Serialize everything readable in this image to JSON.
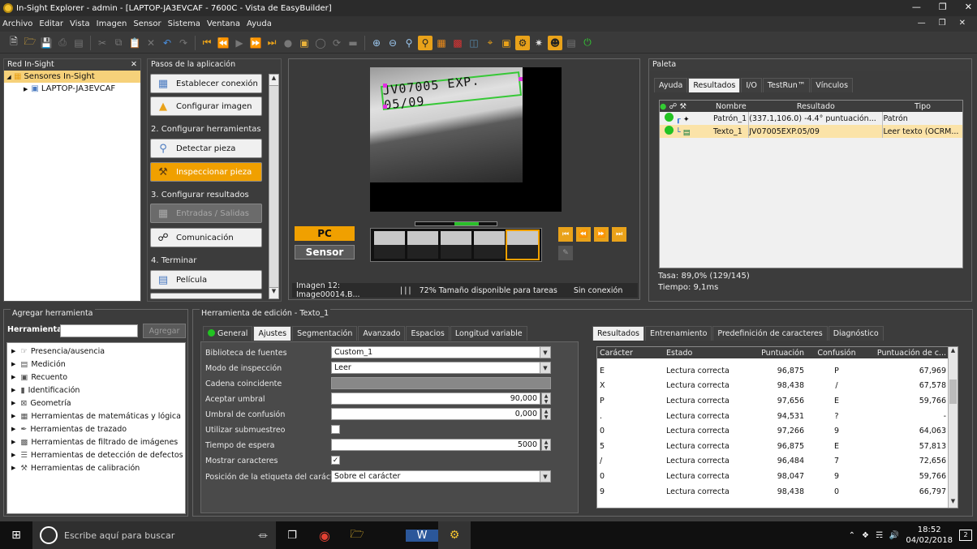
{
  "window": {
    "title": "In-Sight Explorer - admin - [LAPTOP-JA3EVCAF - 7600C - Vista de EasyBuilder]"
  },
  "menu": [
    "Archivo",
    "Editar",
    "Vista",
    "Imagen",
    "Sensor",
    "Sistema",
    "Ventana",
    "Ayuda"
  ],
  "network": {
    "header": "Red In-Sight",
    "root": "Sensores In-Sight",
    "device": "LAPTOP-JA3EVCAF"
  },
  "steps": {
    "header": "Pasos de la aplicación",
    "btn_connect": "Establecer conexión",
    "btn_config_image": "Configurar imagen",
    "section2": "2. Configurar herramientas",
    "btn_detect": "Detectar pieza",
    "btn_inspect": "Inspeccionar pieza",
    "section3": "3. Configurar resultados",
    "btn_io": "Entradas / Salidas",
    "btn_comm": "Comunicación",
    "section4": "4. Terminar",
    "btn_film": "Película"
  },
  "viewer": {
    "ocr_text": "JV07005 EXP. 05/09",
    "pc_label": "PC",
    "sensor_label": "Sensor",
    "image_info": "Imagen 12: Image00014.B...",
    "size_info": "72% Tamaño disponible para tareas",
    "conn_info": "Sin conexión"
  },
  "palette": {
    "header": "Paleta",
    "tabs": [
      "Ayuda",
      "Resultados",
      "I/O",
      "TestRun™",
      "Vínculos"
    ],
    "active_tab": "Resultados",
    "columns": [
      "Nombre",
      "Resultado",
      "Tipo"
    ],
    "rows": [
      {
        "name": "Patrón_1",
        "result": "(337.1,106.0)  -4.4°  puntuación...",
        "type": "Patrón",
        "status_color": "#22c322"
      },
      {
        "name": "Texto_1",
        "result": "JV07005EXP.05/09",
        "type": "Leer texto (OCRM...",
        "status_color": "#22c322"
      }
    ],
    "rate": "Tasa: 89,0% (129/145)",
    "time": "Tiempo: 9,1ms"
  },
  "add_tool": {
    "header": "Agregar herramienta",
    "label": "Herramienta:",
    "button": "Agregar",
    "items": [
      "Presencia/ausencia",
      "Medición",
      "Recuento",
      "Identificación",
      "Geometría",
      "Herramientas de matemáticas y lógica",
      "Herramientas de trazado",
      "Herramientas de filtrado de imágenes",
      "Herramientas de detección de defectos",
      "Herramientas de calibración"
    ]
  },
  "edit_tool": {
    "header": "Herramienta de edición - Texto_1",
    "tabs": [
      "General",
      "Ajustes",
      "Segmentación",
      "Avanzado",
      "Espacios",
      "Longitud variable"
    ],
    "active_tab": "Ajustes",
    "fields": {
      "font_lib_label": "Biblioteca de fuentes",
      "font_lib_value": "Custom_1",
      "mode_label": "Modo de inspección",
      "mode_value": "Leer",
      "match_label": "Cadena coincidente",
      "accept_label": "Aceptar umbral",
      "accept_value": "90,000",
      "confusion_label": "Umbral de confusión",
      "confusion_value": "0,000",
      "subsample_label": "Utilizar submuestreo",
      "timeout_label": "Tiempo de espera",
      "timeout_value": "5000",
      "show_chars_label": "Mostrar caracteres",
      "label_pos_label": "Posición de la etiqueta del carácter",
      "label_pos_value": "Sobre el carácter"
    },
    "result_tabs": [
      "Resultados",
      "Entrenamiento",
      "Predefinición de caracteres",
      "Diagnóstico"
    ],
    "result_active": "Resultados",
    "columns": [
      "Carácter",
      "Estado",
      "Puntuación",
      "Confusión",
      "Puntuación de c..."
    ],
    "rows": [
      [
        "E",
        "Lectura correcta",
        "96,875",
        "P",
        "67,969"
      ],
      [
        "X",
        "Lectura correcta",
        "98,438",
        "/",
        "67,578"
      ],
      [
        "P",
        "Lectura correcta",
        "97,656",
        "E",
        "59,766"
      ],
      [
        ".",
        "Lectura correcta",
        "94,531",
        "?",
        "-"
      ],
      [
        "0",
        "Lectura correcta",
        "97,266",
        "9",
        "64,063"
      ],
      [
        "5",
        "Lectura correcta",
        "96,875",
        "E",
        "57,813"
      ],
      [
        "/",
        "Lectura correcta",
        "96,484",
        "7",
        "72,656"
      ],
      [
        "0",
        "Lectura correcta",
        "98,047",
        "9",
        "59,766"
      ],
      [
        "9",
        "Lectura correcta",
        "98,438",
        "0",
        "66,797"
      ]
    ]
  },
  "taskbar": {
    "search": "Escribe aquí para buscar",
    "time": "18:52",
    "date": "04/02/2018",
    "notif": "2"
  }
}
